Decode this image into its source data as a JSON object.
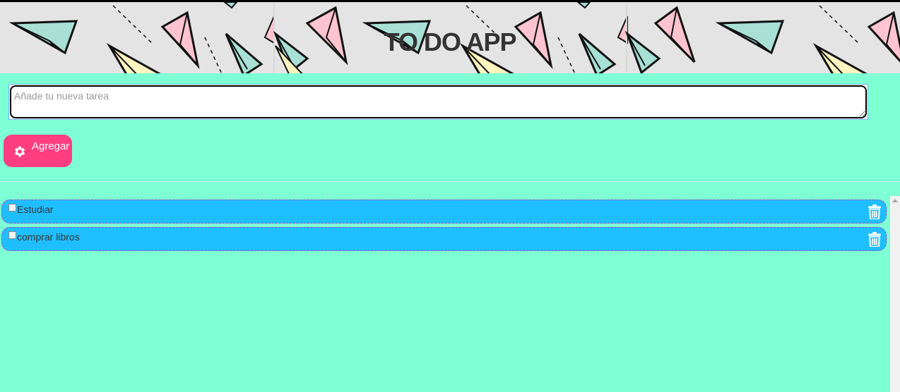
{
  "header": {
    "title": "TO DO APP"
  },
  "new_task": {
    "placeholder": "Añade tu nueva tarea",
    "value": ""
  },
  "add_button": {
    "label": "Agregar",
    "icon": "gear-icon"
  },
  "tasks": [
    {
      "label": "Estudiar",
      "done": false
    },
    {
      "label": "comprar libros",
      "done": false
    }
  ],
  "colors": {
    "background": "#7fffd4",
    "header_background": "#e4e4e4",
    "add_button": "#ff3e7f",
    "task_background": "#1fbfff"
  }
}
